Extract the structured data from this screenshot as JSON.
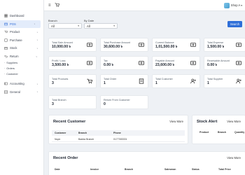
{
  "sidebar": {
    "items": [
      {
        "label": "Dashboard",
        "icon": "dashboard-icon",
        "chevron": false,
        "active": false
      },
      {
        "label": "POS",
        "icon": "pos-icon",
        "chevron": true,
        "active": true
      },
      {
        "label": "Product",
        "icon": "product-icon",
        "chevron": true,
        "active": false
      },
      {
        "label": "Purchase",
        "icon": "purchase-icon",
        "chevron": true,
        "active": false
      },
      {
        "label": "Stock",
        "icon": "stock-icon",
        "chevron": true,
        "active": false
      },
      {
        "label": "Return",
        "icon": "return-icon",
        "chevron": true,
        "active": false
      }
    ],
    "subitems": [
      {
        "label": "Suppliers"
      },
      {
        "label": "Orders"
      },
      {
        "label": "Customer"
      }
    ],
    "lower_items": [
      {
        "label": "Accounting",
        "icon": "accounting-icon",
        "chevron": true
      },
      {
        "label": "General",
        "icon": "general-icon",
        "chevron": true
      }
    ]
  },
  "topbar": {
    "menu_icon": "hamburger-icon",
    "cart_icon": "cart-icon",
    "shop_label": "Shop A"
  },
  "filters": {
    "branch_label": "Branch",
    "branch_value": "All",
    "bydate_label": "By Date",
    "bydate_value": "All",
    "search_label": "Search"
  },
  "cards": [
    {
      "label": "Total Sale Amount",
      "value": "10,000.00 ৳",
      "icon": "money-icon"
    },
    {
      "label": "Total Purchase Amount",
      "value": "30,600.00 ৳",
      "icon": "money-icon"
    },
    {
      "label": "Current Balance",
      "value": "1,01,500.00 ৳",
      "icon": "money-icon"
    },
    {
      "label": "Total Expense",
      "value": "1,500.00 ৳",
      "icon": "money-icon"
    },
    {
      "label": "Profit / Loss",
      "value": "3,500.00 ৳",
      "icon": "money-icon"
    },
    {
      "label": "Tax",
      "value": "0.00 ৳",
      "icon": "money-icon"
    },
    {
      "label": "Payable Amount",
      "value": "23,600.00 ৳",
      "icon": "money-icon"
    },
    {
      "label": "Receivable Amount",
      "value": "0.00 ৳",
      "icon": "money-icon"
    },
    {
      "label": "Total Products",
      "value": "3",
      "icon": "cart-icon"
    },
    {
      "label": "Total Order",
      "value": "1",
      "icon": "order-icon"
    },
    {
      "label": "Total Customer",
      "value": "1",
      "icon": "add-user-icon"
    },
    {
      "label": "Total Supplier",
      "value": "1",
      "icon": "add-user-icon"
    },
    {
      "label": "Total Branch",
      "value": "3",
      "icon": ""
    },
    {
      "label": "Return From Customer",
      "value": "0",
      "icon": ""
    }
  ],
  "recent_customer": {
    "title": "Recent Customer",
    "view_more": "View More",
    "columns": [
      "Customer",
      "Branch",
      "Phone"
    ],
    "rows": [
      [
        "Nupn",
        "Badda Branch",
        "0177300001"
      ]
    ]
  },
  "stock_alert": {
    "title": "Stock Alert",
    "view_more": "View More",
    "columns": [
      "Product",
      "Branch",
      "Quantity"
    ]
  },
  "recent_order": {
    "title": "Recent Order",
    "view_more": "View More",
    "columns": [
      "Date",
      "Invoice",
      "Branch",
      "Salesman",
      "Status",
      "Total Price"
    ]
  }
}
